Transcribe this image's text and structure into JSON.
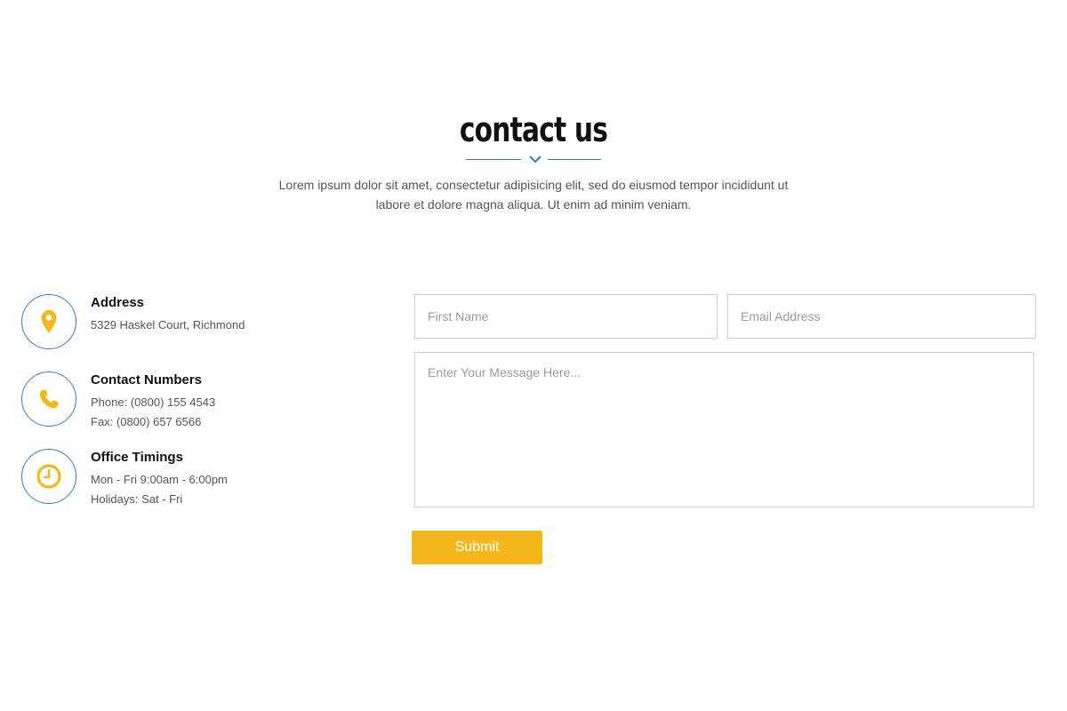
{
  "header": {
    "title": "contact us",
    "intro_line1": "Lorem ipsum dolor sit amet, consectetur adipisicing elit, sed do eiusmod tempor incididunt ut",
    "intro_line2": "labore et dolore magna aliqua. Ut enim ad minim veniam."
  },
  "info": {
    "address": {
      "icon": "map-pin-icon",
      "title": "Address",
      "lines": [
        "5329 Haskel Court, Richmond"
      ]
    },
    "numbers": {
      "icon": "phone-icon",
      "title": "Contact Numbers",
      "lines": [
        "Phone: (0800) 155 4543",
        "Fax: (0800) 657 6566"
      ]
    },
    "timings": {
      "icon": "clock-icon",
      "title": "Office Timings",
      "lines": [
        "Mon - Fri 9:00am - 6:00pm",
        "Holidays: Sat - Fri"
      ]
    }
  },
  "form": {
    "first_name": {
      "value": "",
      "placeholder": "First Name"
    },
    "email": {
      "value": "",
      "placeholder": "Email Address"
    },
    "message": {
      "value": "",
      "placeholder": "Enter Your Message Here..."
    },
    "submit_label": "Submit"
  },
  "colors": {
    "accent_blue": "#2f7ec9",
    "accent_yellow": "#f4b81c",
    "text_dark": "#111111",
    "text_muted": "#555555"
  }
}
